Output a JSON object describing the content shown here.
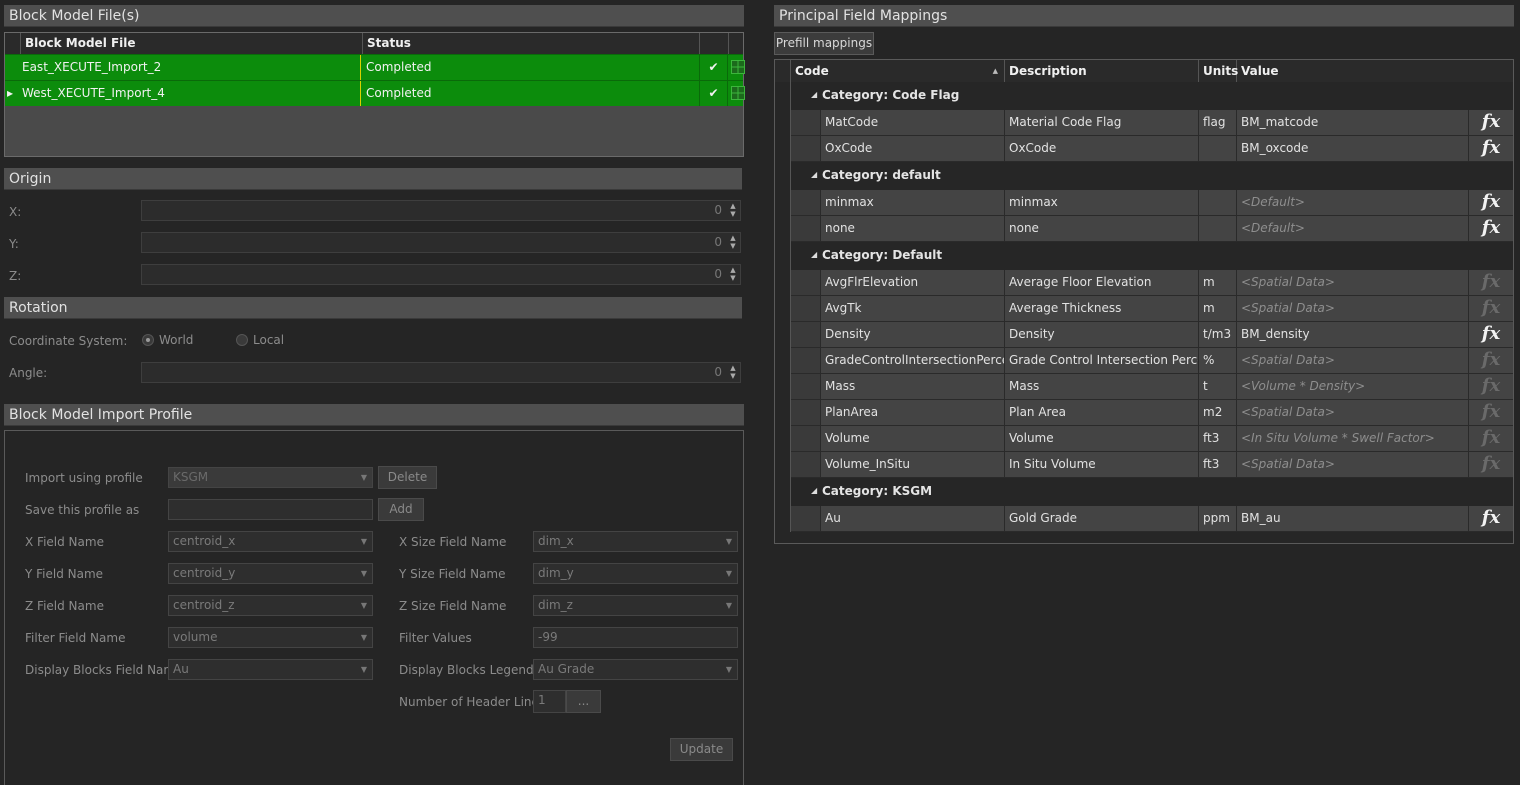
{
  "block_model": {
    "header": "Block Model File(s)",
    "columns": [
      "Block Model File",
      "Status"
    ],
    "rows": [
      {
        "file": "East_XECUTE_Import_2",
        "status": "Completed",
        "selected": false
      },
      {
        "file": "West_XECUTE_Import_4",
        "status": "Completed",
        "selected": true
      }
    ],
    "row_indicator": "▸",
    "check_glyph": "✔"
  },
  "origin": {
    "header": "Origin",
    "fields": [
      {
        "label": "X:",
        "value": "0"
      },
      {
        "label": "Y:",
        "value": "0"
      },
      {
        "label": "Z:",
        "value": "0"
      }
    ]
  },
  "rotation": {
    "header": "Rotation",
    "coord_label": "Coordinate System:",
    "options": [
      {
        "label": "World",
        "checked": true
      },
      {
        "label": "Local",
        "checked": false
      }
    ],
    "angle_label": "Angle:",
    "angle_value": "0"
  },
  "profile": {
    "header": "Block Model Import Profile",
    "import_label": "Import using profile",
    "import_value": "KSGM",
    "delete_label": "Delete",
    "save_label": "Save this profile as",
    "save_value": "",
    "add_label": "Add",
    "x_field_label": "X Field Name",
    "x_field_value": "centroid_x",
    "y_field_label": "Y Field Name",
    "y_field_value": "centroid_y",
    "z_field_label": "Z Field Name",
    "z_field_value": "centroid_z",
    "filter_field_label": "Filter Field Name",
    "filter_field_value": "volume",
    "display_field_label": "Display Blocks Field Name",
    "display_field_value": "Au",
    "x_size_label": "X Size Field Name",
    "x_size_value": "dim_x",
    "y_size_label": "Y Size Field Name",
    "y_size_value": "dim_y",
    "z_size_label": "Z Size Field Name",
    "z_size_value": "dim_z",
    "filter_values_label": "Filter Values",
    "filter_values_value": "-99",
    "legend_label": "Display Blocks Legend",
    "legend_value": "Au Grade",
    "header_lines_label": "Number of Header Lines",
    "header_lines_value": "1",
    "ellipsis_label": "...",
    "update_label": "Update"
  },
  "mappings": {
    "header": "Principal Field Mappings",
    "prefill_label": "Prefill mappings",
    "columns": [
      "Code",
      "Description",
      "Units",
      "Value"
    ],
    "fx_glyph": "fx",
    "categories": [
      {
        "title": "Category: Code Flag",
        "rows": [
          {
            "code": "MatCode",
            "description": "Material Code Flag",
            "units": "flag",
            "value": "BM_matcode",
            "derived": false
          },
          {
            "code": "OxCode",
            "description": "OxCode",
            "units": "",
            "value": "BM_oxcode",
            "derived": false
          }
        ]
      },
      {
        "title": "Category: default",
        "rows": [
          {
            "code": "minmax",
            "description": "minmax",
            "units": "",
            "value": "<Default>",
            "derived": true,
            "fx_active": true
          },
          {
            "code": "none",
            "description": "none",
            "units": "",
            "value": "<Default>",
            "derived": true,
            "fx_active": true
          }
        ]
      },
      {
        "title": "Category: Default",
        "rows": [
          {
            "code": "AvgFlrElevation",
            "description": "Average Floor Elevation",
            "units": "m",
            "value": "<Spatial Data>",
            "derived": true
          },
          {
            "code": "AvgTk",
            "description": "Average Thickness",
            "units": "m",
            "value": "<Spatial Data>",
            "derived": true
          },
          {
            "code": "Density",
            "description": "Density",
            "units": "t/m3",
            "value": "BM_density",
            "derived": false
          },
          {
            "code": "GradeControlIntersectionPercent",
            "description": "Grade Control Intersection Percent",
            "units": "%",
            "value": "<Spatial Data>",
            "derived": true
          },
          {
            "code": "Mass",
            "description": "Mass",
            "units": "t",
            "value": "<Volume * Density>",
            "derived": true
          },
          {
            "code": "PlanArea",
            "description": "Plan Area",
            "units": "m2",
            "value": "<Spatial Data>",
            "derived": true
          },
          {
            "code": "Volume",
            "description": "Volume",
            "units": "ft3",
            "value": "<In Situ Volume * Swell Factor>",
            "derived": true
          },
          {
            "code": "Volume_InSitu",
            "description": "In Situ Volume",
            "units": "ft3",
            "value": "<Spatial Data>",
            "derived": true
          }
        ]
      },
      {
        "title": "Category: KSGM",
        "rows": [
          {
            "code": "Au",
            "description": "Gold Grade",
            "units": "ppm",
            "value": "BM_au",
            "derived": false
          }
        ]
      }
    ]
  }
}
